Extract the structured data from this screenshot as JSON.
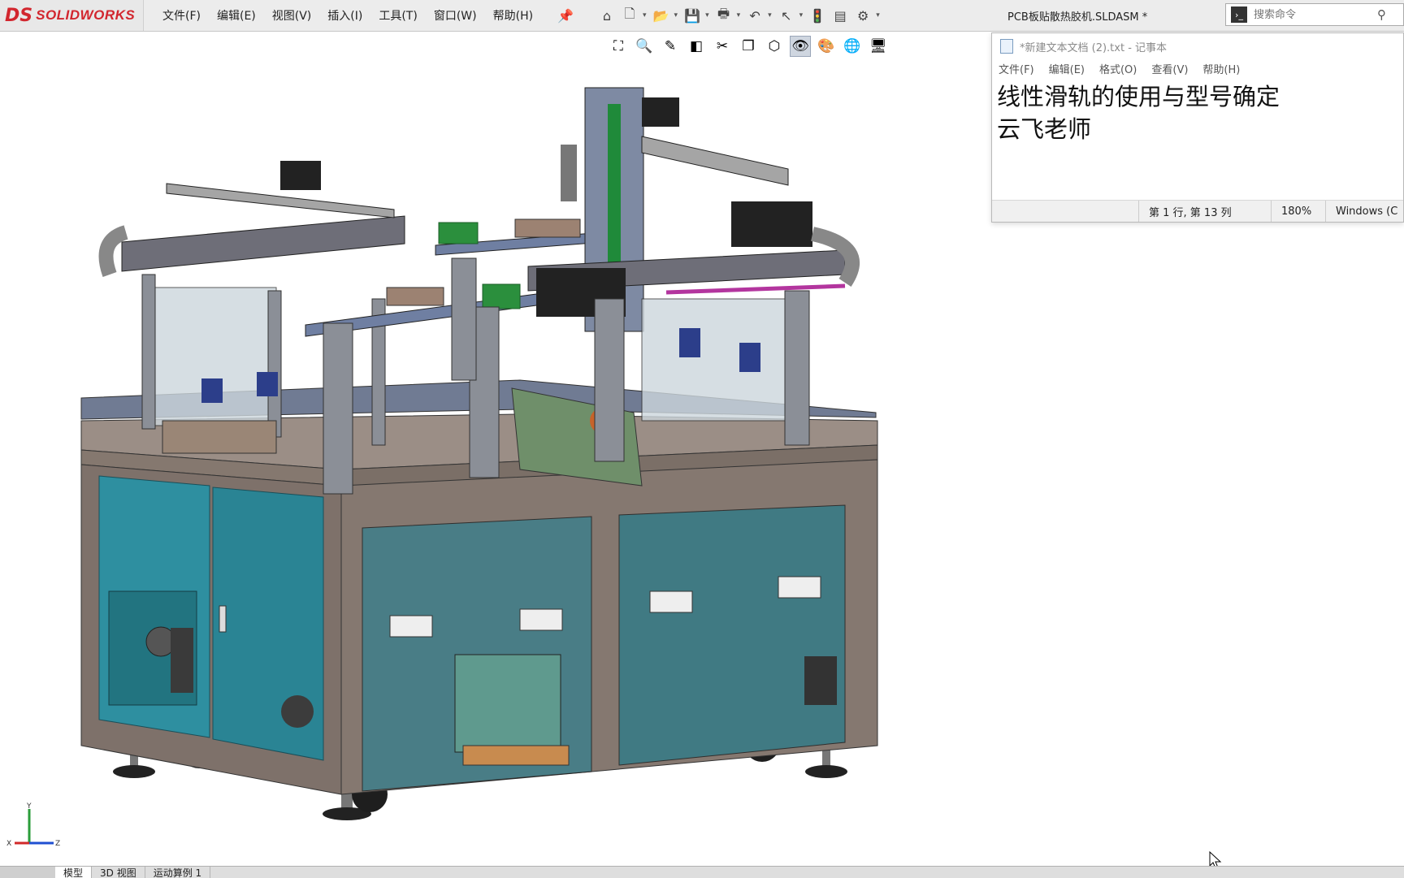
{
  "app": {
    "logo_mark": "DS",
    "logo_text": "SOLIDWORKS"
  },
  "menu": [
    "文件(F)",
    "编辑(E)",
    "视图(V)",
    "插入(I)",
    "工具(T)",
    "窗口(W)",
    "帮助(H)"
  ],
  "document_title": "PCB板贴散热胶机.SLDASM *",
  "search": {
    "placeholder": "搜索命令"
  },
  "notepad": {
    "title": "*新建文本文档 (2).txt - 记事本",
    "menu": [
      "文件(F)",
      "编辑(E)",
      "格式(O)",
      "查看(V)",
      "帮助(H)"
    ],
    "lines": [
      "线性滑轨的使用与型号确定",
      "",
      "云飞老师"
    ],
    "status": {
      "position": "第 1 行, 第 13 列",
      "zoom": "180%",
      "encoding": "Windows (C"
    }
  },
  "tabs": [
    "模型",
    "3D 视图",
    "运动算例 1"
  ],
  "triad": {
    "x": "X",
    "y": "Y",
    "z": "Z"
  },
  "colors": {
    "accent": "#d2262e",
    "cabinet_teal": "#2e8fa0",
    "frame": "#8b7d74"
  }
}
